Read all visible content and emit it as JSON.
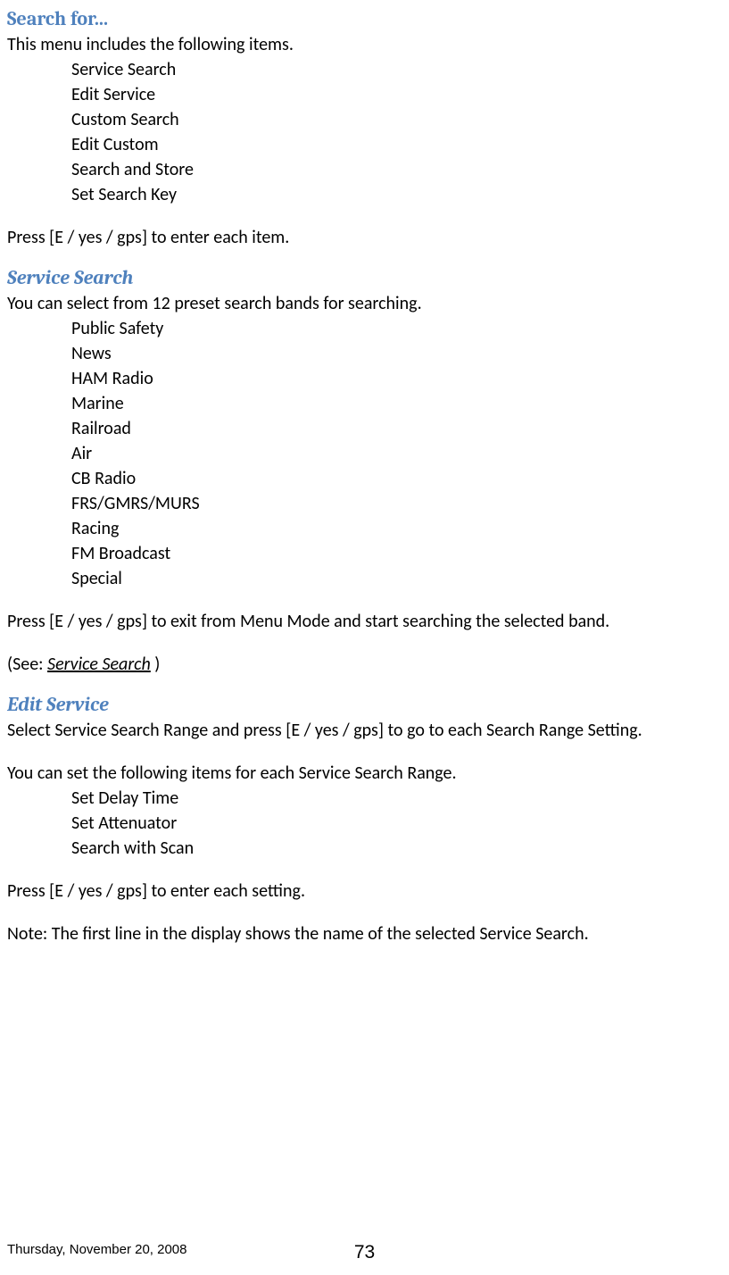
{
  "headings": {
    "searchFor": "Search for...",
    "serviceSearch": "Service Search",
    "editService": "Edit Service"
  },
  "searchFor": {
    "intro": "This menu includes the following items.",
    "items": {
      "0": "Service Search",
      "1": "Edit Service",
      "2": "Custom Search",
      "3": "Edit Custom",
      "4": "Search and Store",
      "5": "Set Search Key"
    },
    "pressNote": "Press [E / yes / gps] to enter each item."
  },
  "serviceSearch": {
    "intro": "You can select from 12 preset search bands for searching.",
    "items": {
      "0": "Public Safety",
      "1": "News",
      "2": "HAM Radio",
      "3": "Marine",
      "4": "Railroad",
      "5": "Air",
      "6": "CB Radio",
      "7": "FRS/GMRS/MURS",
      "8": "Racing",
      "9": "FM Broadcast",
      "10": "Special"
    },
    "pressNote": "Press [E / yes / gps] to exit from Menu Mode and start searching the selected band.",
    "seePrefix": "(See: ",
    "seeLink": "Service Search",
    "seeSuffix": " )"
  },
  "editService": {
    "intro": "Select Service Search Range and press [E / yes / gps] to go to each Search Range Setting.",
    "canSet": "You can set the following items for each Service Search Range.",
    "items": {
      "0": "Set Delay Time",
      "1": "Set Attenuator",
      "2": "Search with Scan"
    },
    "pressNote": "Press [E / yes / gps] to enter each setting.",
    "note": "Note: The first line in the display shows the name of the selected Service Search."
  },
  "footer": {
    "date": "Thursday, November 20, 2008",
    "page": "73"
  }
}
